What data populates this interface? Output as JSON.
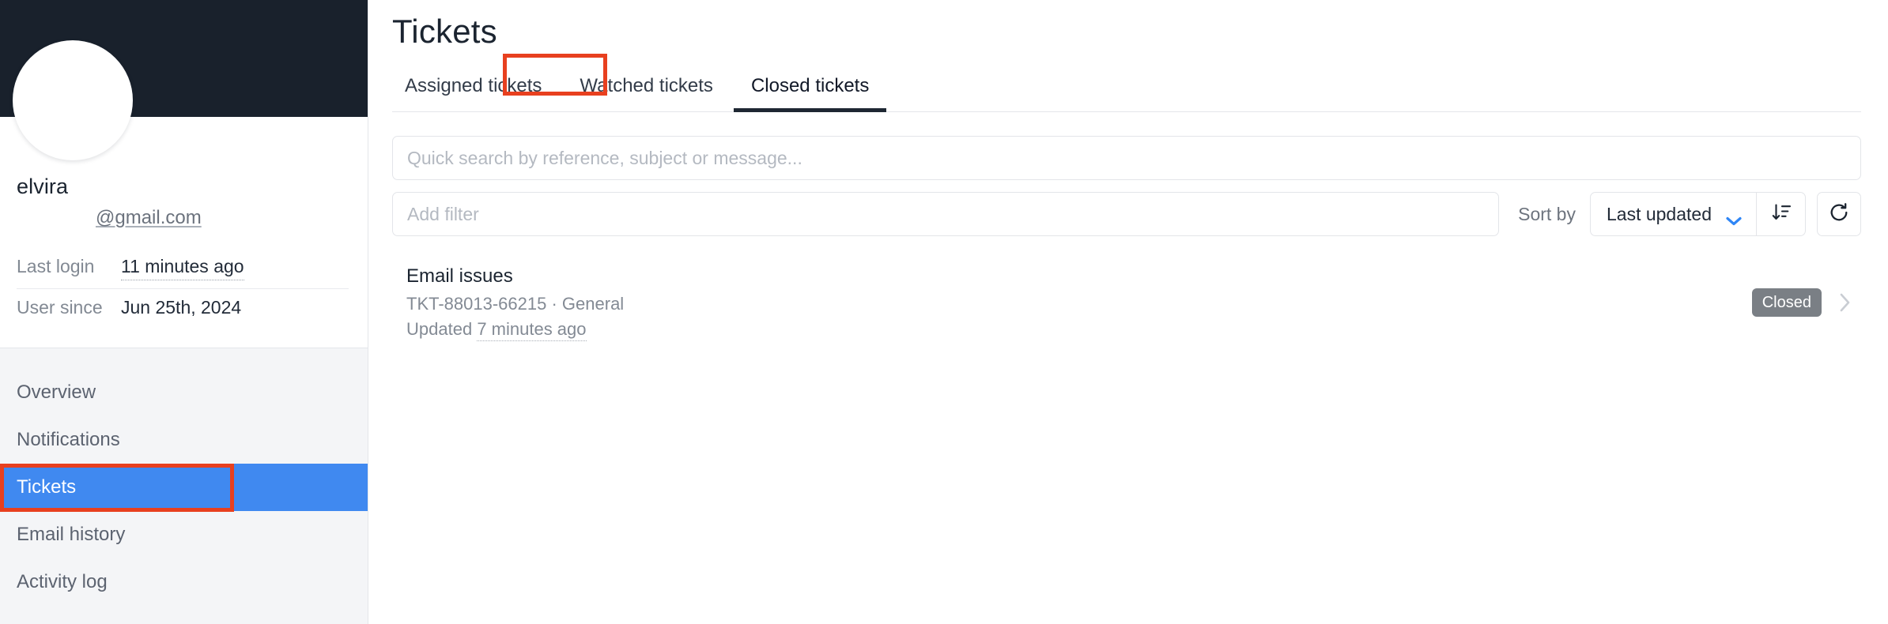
{
  "colors": {
    "banner": "#19212c",
    "accent_blue": "#4089f0",
    "annotation_red": "#e8401f",
    "badge_grey": "#7a7f85",
    "sidebar_bg": "#f4f5f7"
  },
  "sidebar": {
    "profile": {
      "name": "elvira",
      "email": "@gmail.com",
      "meta": [
        {
          "label": "Last login",
          "value": "11 minutes ago",
          "dotted": true
        },
        {
          "label": "User since",
          "value": "Jun 25th, 2024",
          "dotted": false
        }
      ]
    },
    "nav": {
      "items": [
        {
          "label": "Overview",
          "active": false
        },
        {
          "label": "Notifications",
          "active": false
        },
        {
          "label": "Tickets",
          "active": true
        },
        {
          "label": "Email history",
          "active": false
        },
        {
          "label": "Activity log",
          "active": false
        }
      ]
    }
  },
  "main": {
    "title": "Tickets",
    "tabs": [
      {
        "label": "Assigned tickets",
        "active": false
      },
      {
        "label": "Watched tickets",
        "active": false
      },
      {
        "label": "Closed tickets",
        "active": true
      }
    ],
    "search": {
      "value": "",
      "placeholder": "Quick search by reference, subject or message..."
    },
    "filter": {
      "value": "",
      "placeholder": "Add filter"
    },
    "sort": {
      "label": "Sort by",
      "selected": "Last updated",
      "options": [
        "Last updated"
      ],
      "direction_icon": "sort-descending-icon",
      "refresh_icon": "refresh-icon"
    },
    "tickets": [
      {
        "subject": "Email issues",
        "reference": "TKT-88013-66215",
        "separator": "·",
        "category": "General",
        "updated_prefix": "Updated",
        "updated_time": "7 minutes ago",
        "status": "Closed"
      }
    ]
  },
  "annotations": [
    {
      "name": "closed-tickets-tab-highlight",
      "target": "Closed tickets"
    },
    {
      "name": "tickets-nav-highlight",
      "target": "Tickets"
    }
  ]
}
